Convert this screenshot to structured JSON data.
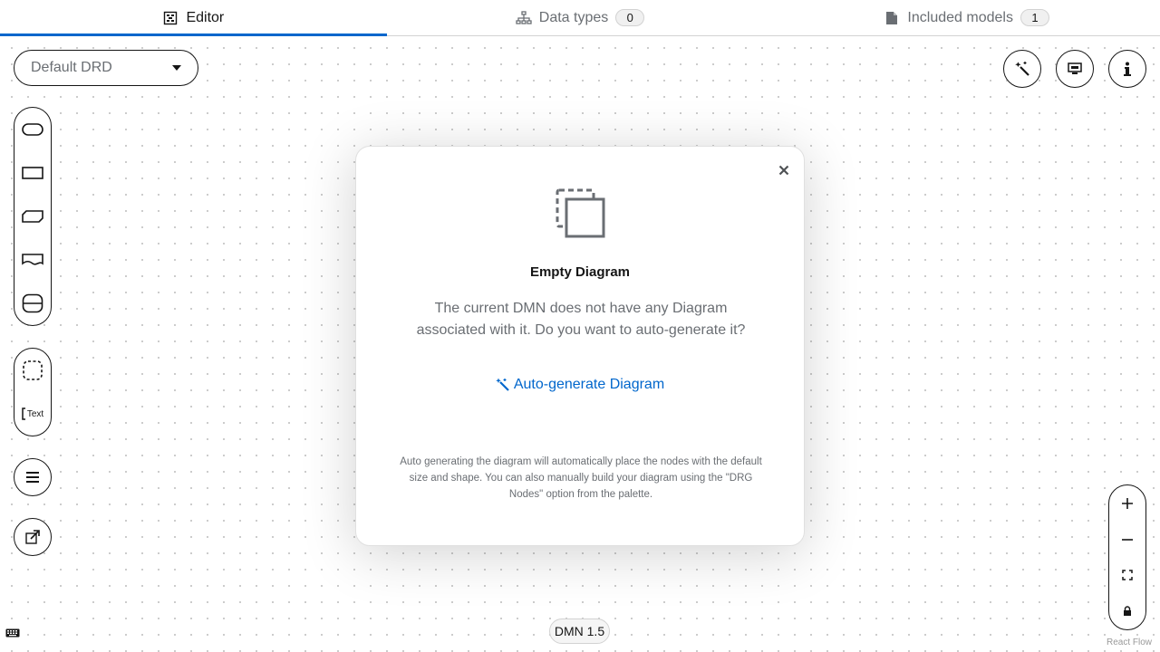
{
  "tabs": [
    {
      "label": "Editor",
      "icon": "diagram-grid-icon",
      "active": true
    },
    {
      "label": "Data types",
      "icon": "hierarchy-icon",
      "count": "0"
    },
    {
      "label": "Included models",
      "icon": "file-icon",
      "count": "1"
    }
  ],
  "drd": {
    "selected": "Default DRD"
  },
  "palette": {
    "drg_nodes": [
      "input-data",
      "decision",
      "business-knowledge-model",
      "knowledge-source",
      "decision-service"
    ],
    "artifacts": [
      "group",
      "text-annotation"
    ],
    "text_annotation_label": "Text"
  },
  "modal": {
    "title": "Empty Diagram",
    "body": "The current DMN does not have any Diagram associated with it. Do you want to auto-generate it?",
    "link": "Auto-generate Diagram",
    "note": "Auto generating the diagram will automatically place the nodes with the default size and shape. You can also manually build your diagram using the \"DRG Nodes\" option from the palette."
  },
  "footer": {
    "version": "DMN 1.5",
    "react_flow": "React Flow"
  },
  "colors": {
    "accent": "#0066cc",
    "border": "#151515",
    "muted": "#6a6e73"
  }
}
